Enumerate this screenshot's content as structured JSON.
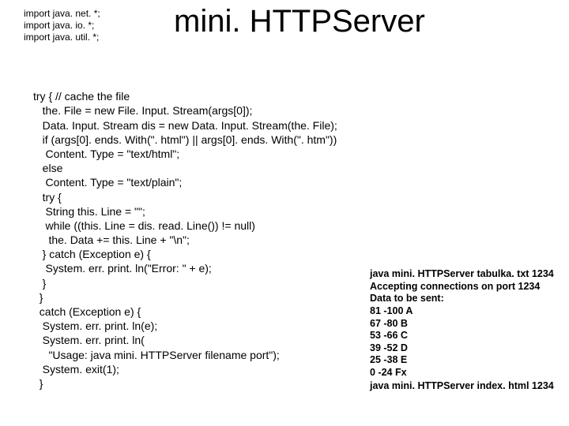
{
  "imports": {
    "l1": "import java. net. *;",
    "l2": "import java. io. *;",
    "l3": "import java. util. *;"
  },
  "title": "mini. HTTPServer",
  "code": {
    "l01": "try { // cache the file",
    "l02": "   the. File = new File. Input. Stream(args[0]);",
    "l03": "   Data. Input. Stream dis = new Data. Input. Stream(the. File);",
    "l04": "   if (args[0]. ends. With(\". html\") || args[0]. ends. With(\". htm\"))",
    "l05": "    Content. Type = \"text/html\";",
    "l06": "   else",
    "l07": "    Content. Type = \"text/plain\";",
    "l08": "   try {",
    "l09": "    String this. Line = \"\";",
    "l10": "    while ((this. Line = dis. read. Line()) != null)",
    "l11": "     the. Data += this. Line + \"\\n\";",
    "l12": "   } catch (Exception e) {",
    "l13": "    System. err. print. ln(\"Error: \" + e);",
    "l14": "   }",
    "l15": "  }",
    "l16": "  catch (Exception e) {",
    "l17": "   System. err. print. ln(e);",
    "l18": "   System. err. print. ln(",
    "l19": "     \"Usage: java mini. HTTPServer filename port\");",
    "l20": "   System. exit(1);",
    "l21": "  }"
  },
  "output": {
    "l1": "java mini. HTTPServer tabulka. txt 1234",
    "l2": "Accepting connections on port 1234",
    "l3": "Data to be sent:",
    "l4": "81 -100 A",
    "l5": "67 -80   B",
    "l6": "53 -66   C",
    "l7": "39 -52   D",
    "l8": "25 -38   E",
    "l9": "0 -24    Fx"
  },
  "cmd2": "java mini. HTTPServer index. html 1234"
}
